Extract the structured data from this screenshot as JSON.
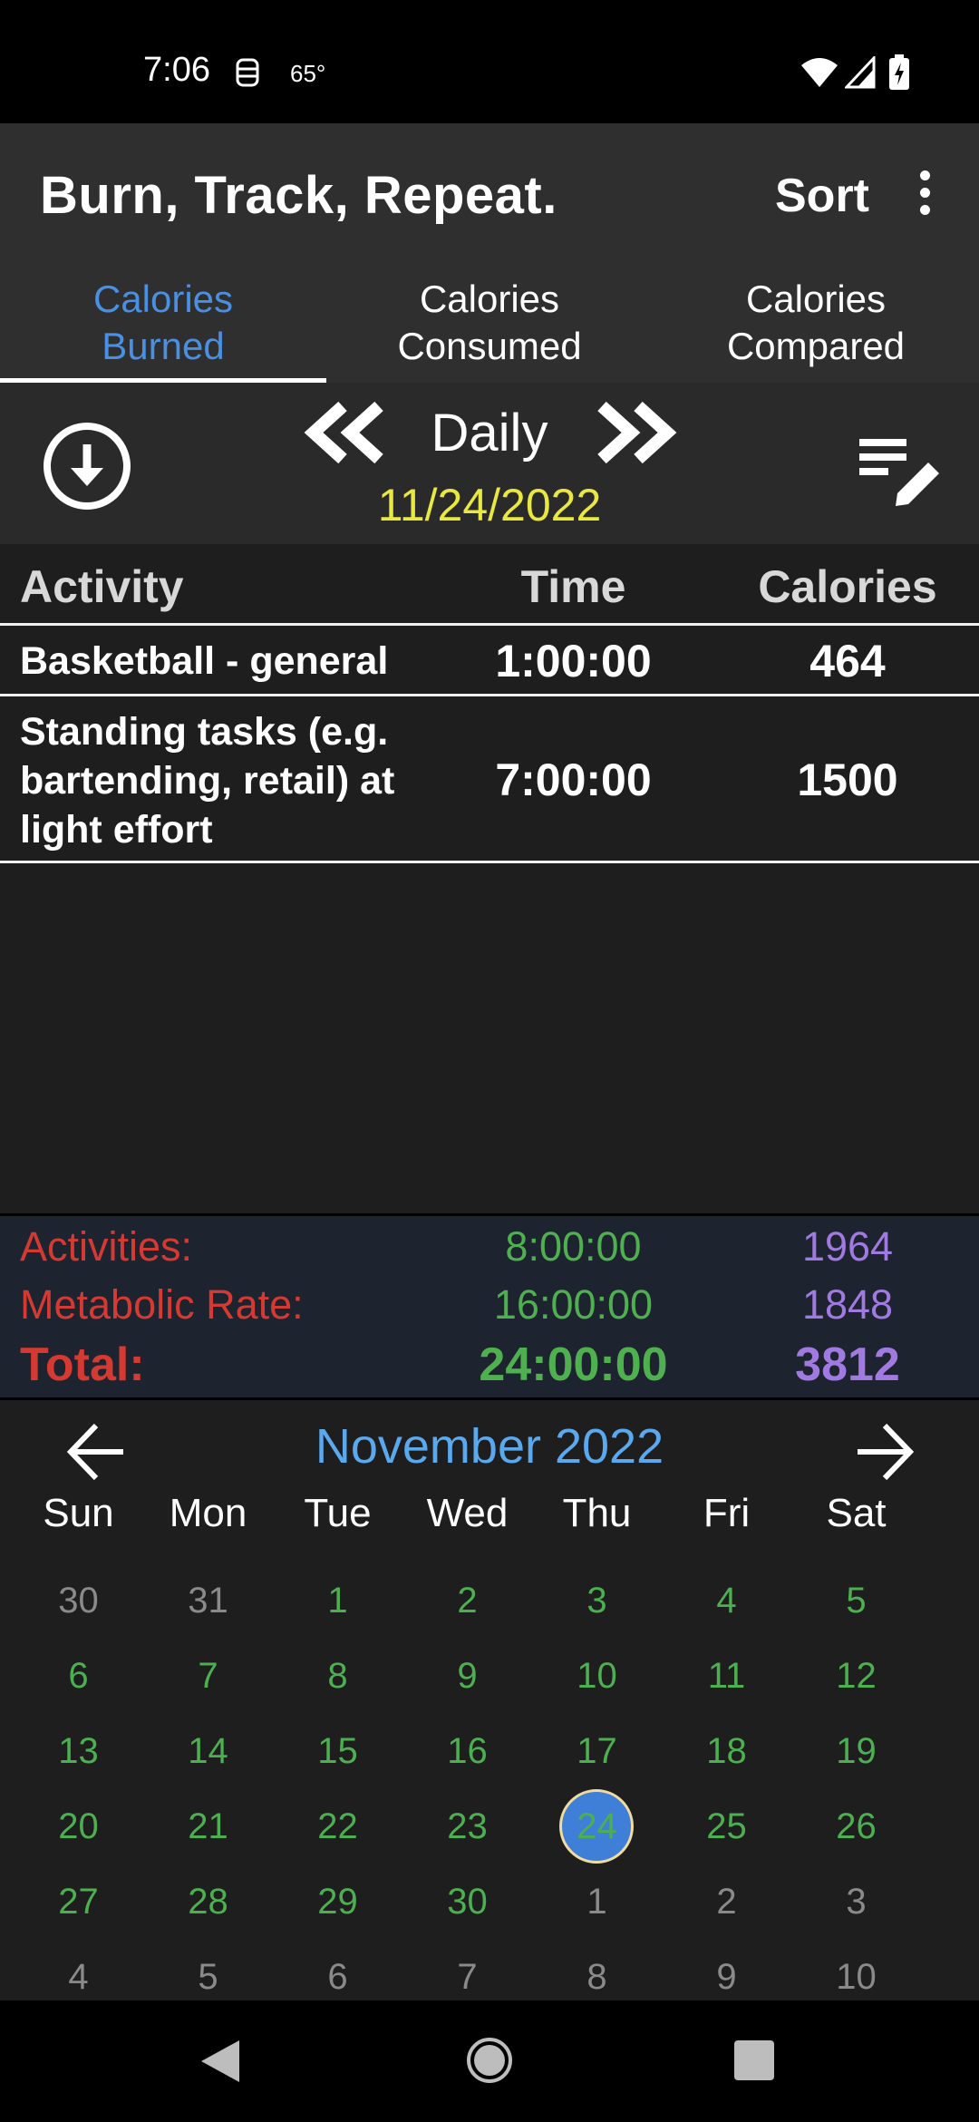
{
  "status_bar": {
    "time": "7:06",
    "temperature": "65°"
  },
  "app_bar": {
    "title": "Burn, Track, Repeat.",
    "sort_label": "Sort"
  },
  "tabs": [
    {
      "line1": "Calories",
      "line2": "Burned",
      "active": true
    },
    {
      "line1": "Calories",
      "line2": "Consumed",
      "active": false
    },
    {
      "line1": "Calories",
      "line2": "Compared",
      "active": false
    }
  ],
  "period": {
    "label": "Daily",
    "date": "11/24/2022"
  },
  "table": {
    "headers": {
      "activity": "Activity",
      "time": "Time",
      "calories": "Calories"
    },
    "rows": [
      {
        "activity": "Basketball - general",
        "time": "1:00:00",
        "calories": "464"
      },
      {
        "activity": "Standing tasks (e.g. bartending, retail) at light effort",
        "time": "7:00:00",
        "calories": "1500"
      }
    ]
  },
  "totals": {
    "activities": {
      "label": "Activities:",
      "time": "8:00:00",
      "calories": "1964"
    },
    "metabolic": {
      "label": "Metabolic Rate:",
      "time": "16:00:00",
      "calories": "1848"
    },
    "total": {
      "label": "Total:",
      "time": "24:00:00",
      "calories": "3812"
    }
  },
  "calendar": {
    "month": "November 2022",
    "weekdays": [
      "Sun",
      "Mon",
      "Tue",
      "Wed",
      "Thu",
      "Fri",
      "Sat"
    ],
    "weeks": [
      [
        {
          "d": "30",
          "in": false
        },
        {
          "d": "31",
          "in": false
        },
        {
          "d": "1",
          "in": true
        },
        {
          "d": "2",
          "in": true
        },
        {
          "d": "3",
          "in": true
        },
        {
          "d": "4",
          "in": true
        },
        {
          "d": "5",
          "in": true
        }
      ],
      [
        {
          "d": "6",
          "in": true
        },
        {
          "d": "7",
          "in": true
        },
        {
          "d": "8",
          "in": true
        },
        {
          "d": "9",
          "in": true
        },
        {
          "d": "10",
          "in": true
        },
        {
          "d": "11",
          "in": true
        },
        {
          "d": "12",
          "in": true
        }
      ],
      [
        {
          "d": "13",
          "in": true
        },
        {
          "d": "14",
          "in": true
        },
        {
          "d": "15",
          "in": true
        },
        {
          "d": "16",
          "in": true
        },
        {
          "d": "17",
          "in": true
        },
        {
          "d": "18",
          "in": true
        },
        {
          "d": "19",
          "in": true
        }
      ],
      [
        {
          "d": "20",
          "in": true
        },
        {
          "d": "21",
          "in": true
        },
        {
          "d": "22",
          "in": true
        },
        {
          "d": "23",
          "in": true
        },
        {
          "d": "24",
          "in": true,
          "selected": true
        },
        {
          "d": "25",
          "in": true
        },
        {
          "d": "26",
          "in": true
        }
      ],
      [
        {
          "d": "27",
          "in": true
        },
        {
          "d": "28",
          "in": true
        },
        {
          "d": "29",
          "in": true
        },
        {
          "d": "30",
          "in": true
        },
        {
          "d": "1",
          "in": false
        },
        {
          "d": "2",
          "in": false
        },
        {
          "d": "3",
          "in": false
        }
      ],
      [
        {
          "d": "4",
          "in": false
        },
        {
          "d": "5",
          "in": false
        },
        {
          "d": "6",
          "in": false
        },
        {
          "d": "7",
          "in": false
        },
        {
          "d": "8",
          "in": false
        },
        {
          "d": "9",
          "in": false
        },
        {
          "d": "10",
          "in": false
        }
      ]
    ]
  },
  "colors": {
    "active_tab": "#4a90e2",
    "date": "#e8e840",
    "totals_label": "#d43a32",
    "totals_time": "#4fb04f",
    "totals_calories": "#a07ae0",
    "calendar_month": "#5aa8ee",
    "calendar_in_month": "#4caf50",
    "calendar_out_month": "#8a8a8a",
    "selected_day": "#3f7fd8"
  },
  "icons": {
    "status": [
      "notification-icon",
      "wifi-icon",
      "signal-icon",
      "battery-icon"
    ],
    "app_bar": [
      "overflow-menu-icon"
    ],
    "period_nav": [
      "download-icon",
      "double-chevron-left-icon",
      "double-chevron-right-icon",
      "edit-list-icon"
    ],
    "calendar": [
      "arrow-left-icon",
      "arrow-right-icon"
    ],
    "nav_bar": [
      "back-icon",
      "home-icon",
      "recents-icon"
    ]
  }
}
